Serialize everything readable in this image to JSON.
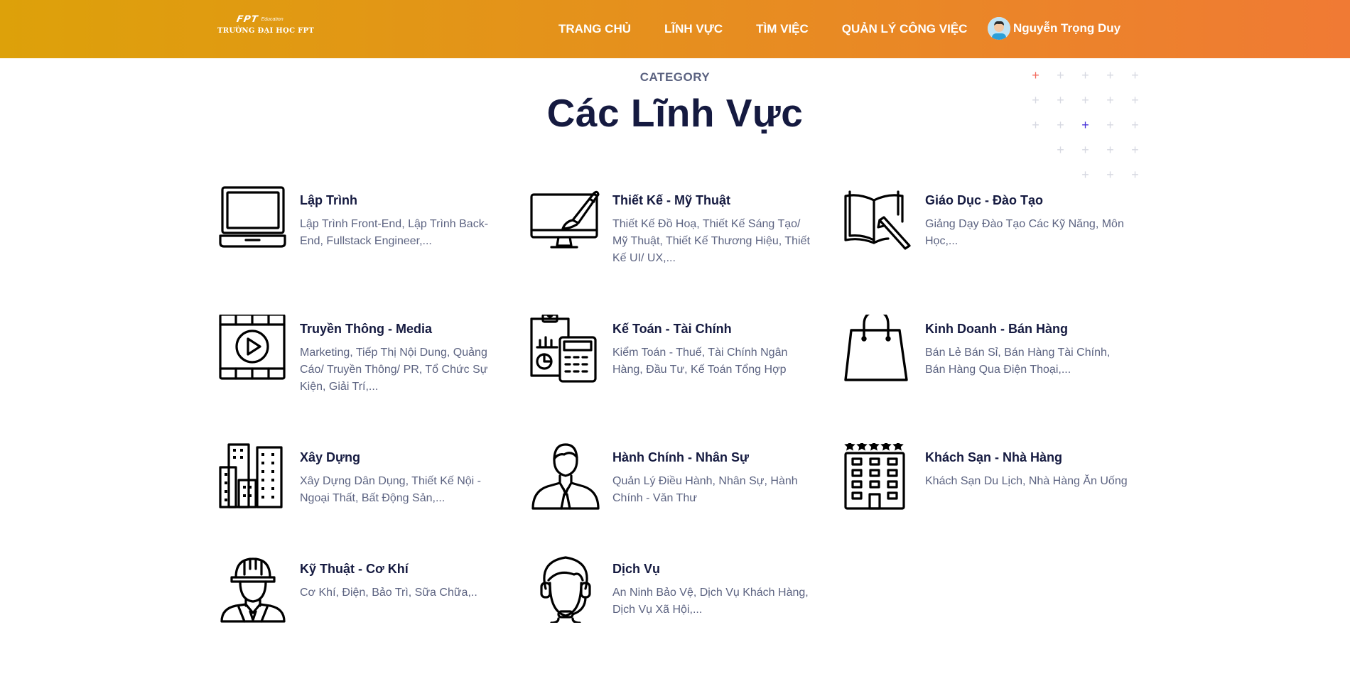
{
  "header": {
    "logo": {
      "brand": "FPT",
      "sub": "Education",
      "school": "TRƯỜNG ĐẠI HỌC FPT"
    },
    "nav": [
      {
        "label": "TRANG CHỦ"
      },
      {
        "label": "LĨNH VỰC"
      },
      {
        "label": "TÌM VIỆC"
      },
      {
        "label": "QUẢN LÝ CÔNG VIỆC"
      }
    ],
    "user": {
      "name": "Nguyễn Trọng Duy",
      "avatar_icon": "user-avatar-icon"
    },
    "gradient_colors": [
      "#dda10a",
      "#f07a34"
    ]
  },
  "section": {
    "eyebrow": "CATEGORY",
    "title": "Các Lĩnh Vực"
  },
  "categories": [
    {
      "name": "Lập Trình",
      "desc": "Lập Trình Front-End, Lập Trình Back-End, Fullstack Engineer,...",
      "icon": "laptop-icon"
    },
    {
      "name": "Thiết Kế - Mỹ Thuật",
      "desc": "Thiết Kế Đồ Hoạ, Thiết Kế Sáng Tạo/ Mỹ Thuật, Thiết Kế Thương Hiệu, Thiết Kế UI/ UX,...",
      "icon": "design-monitor-icon"
    },
    {
      "name": "Giáo Dục - Đào Tạo",
      "desc": "Giảng Dạy Đào Tạo Các Kỹ Năng, Môn Học,...",
      "icon": "book-pencil-icon"
    },
    {
      "name": "Truyền Thông - Media",
      "desc": "Marketing, Tiếp Thị Nội Dung, Quảng Cáo/ Truyền Thông/ PR, Tổ Chức Sự Kiện, Giải Trí,...",
      "icon": "media-film-icon"
    },
    {
      "name": "Kế Toán - Tài Chính",
      "desc": "Kiểm Toán - Thuế, Tài Chính Ngân Hàng, Đầu Tư, Kế Toán Tổng Hợp",
      "icon": "calculator-report-icon"
    },
    {
      "name": "Kinh Doanh - Bán Hàng",
      "desc": "Bán Lẻ Bán Sỉ, Bán Hàng Tài Chính, Bán Hàng Qua Điện Thoại,...",
      "icon": "shopping-bag-icon"
    },
    {
      "name": "Xây Dựng",
      "desc": "Xây Dựng Dân Dụng, Thiết Kế Nội - Ngoại Thất, Bất Động Sản,...",
      "icon": "buildings-icon"
    },
    {
      "name": "Hành Chính - Nhân Sự",
      "desc": "Quản Lý Điều Hành, Nhân Sự, Hành Chính - Văn Thư",
      "icon": "businessman-icon"
    },
    {
      "name": "Khách Sạn - Nhà Hàng",
      "desc": "Khách Sạn Du Lịch, Nhà Hàng Ăn Uống",
      "icon": "hotel-icon"
    },
    {
      "name": "Kỹ Thuật - Cơ Khí",
      "desc": "Cơ Khí, Điện, Bảo Trì, Sữa Chữa,..",
      "icon": "engineer-helmet-icon"
    },
    {
      "name": "Dịch Vụ",
      "desc": "An Ninh Bảo Vệ, Dịch Vụ Khách Hàng, Dịch Vụ Xã Hội,...",
      "icon": "headset-support-icon"
    }
  ],
  "decor": {
    "plus_color": "#d7d9e2",
    "accent_red": "#f36b5e",
    "accent_blue": "#4a35d9"
  }
}
